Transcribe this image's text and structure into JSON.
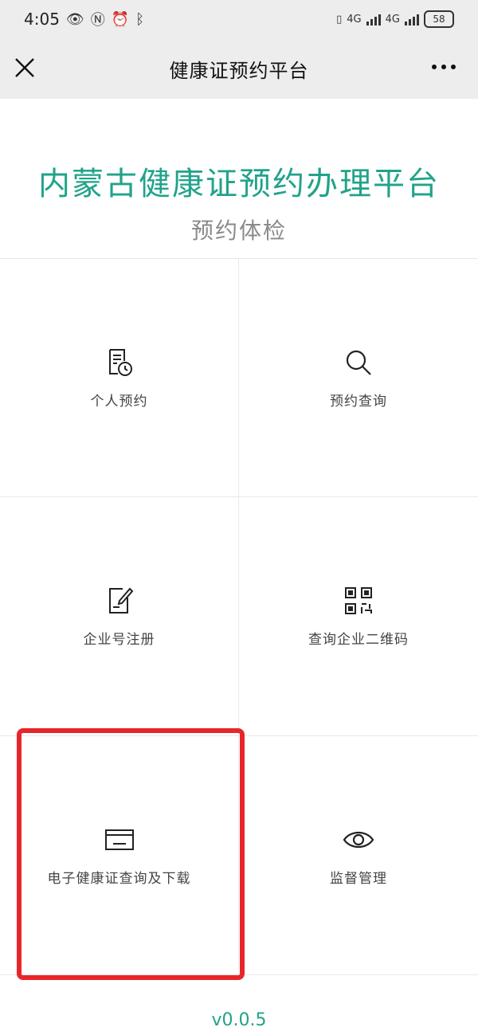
{
  "status": {
    "time": "4:05",
    "network": "4G",
    "network2": "4G",
    "battery": "58"
  },
  "nav": {
    "title": "健康证预约平台"
  },
  "hero": {
    "title": "内蒙古健康证预约办理平台",
    "subtitle": "预约体检"
  },
  "menu": [
    {
      "label": "个人预约",
      "icon": "document-clock-icon"
    },
    {
      "label": "预约查询",
      "icon": "search-icon"
    },
    {
      "label": "企业号注册",
      "icon": "document-edit-icon"
    },
    {
      "label": "查询企业二维码",
      "icon": "qr-code-icon"
    },
    {
      "label": "电子健康证查询及下载",
      "icon": "card-icon"
    },
    {
      "label": "监督管理",
      "icon": "eye-icon"
    }
  ],
  "footer": {
    "version": "v0.0.5"
  },
  "colors": {
    "accent": "#21a38a",
    "highlight": "#e8262a",
    "bar": "#ededed"
  }
}
